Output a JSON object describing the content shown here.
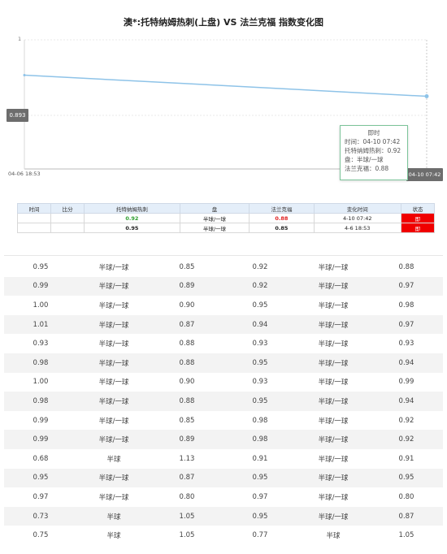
{
  "title": "澳*:托特纳姆热刺(上盘) VS 法兰克福 指数变化图",
  "chart_data": {
    "type": "line",
    "x": [
      "04-06 18:53",
      "04-10 07:42"
    ],
    "series": [
      {
        "values": [
          0.95,
          0.92
        ]
      }
    ],
    "ylim": [
      0.893,
      1
    ],
    "ytick_label": "1",
    "y_cursor_label": "0.893",
    "x_start_label": "04-06 18:53",
    "x_cursor_label": "04-10 07:42",
    "line_color": "#8ec3e8"
  },
  "tooltip": {
    "header": "即时",
    "time": "时间：04-10 07:42",
    "home": "托特纳姆热刺：0.92",
    "handicap": "盘：半球/一球",
    "away": "法兰克福：0.88"
  },
  "small_table": {
    "headers": [
      "时间",
      "比分",
      "托特纳姆热刺",
      "盘",
      "法兰克福",
      "变化时间",
      "状态"
    ],
    "rows": [
      [
        "",
        "",
        "0.92",
        "半球/一球",
        "0.88",
        "4-10 07:42",
        "即"
      ],
      [
        "",
        "",
        "0.95",
        "半球/一球",
        "0.85",
        "4-6 18:53",
        "即"
      ]
    ]
  },
  "big_table": [
    [
      "0.95",
      "半球/一球",
      "0.85",
      "0.92",
      "半球/一球",
      "0.88"
    ],
    [
      "0.99",
      "半球/一球",
      "0.89",
      "0.92",
      "半球/一球",
      "0.97"
    ],
    [
      "1.00",
      "半球/一球",
      "0.90",
      "0.95",
      "半球/一球",
      "0.98"
    ],
    [
      "1.01",
      "半球/一球",
      "0.87",
      "0.94",
      "半球/一球",
      "0.97"
    ],
    [
      "0.93",
      "半球/一球",
      "0.88",
      "0.93",
      "半球/一球",
      "0.93"
    ],
    [
      "0.98",
      "半球/一球",
      "0.88",
      "0.95",
      "半球/一球",
      "0.94"
    ],
    [
      "1.00",
      "半球/一球",
      "0.90",
      "0.93",
      "半球/一球",
      "0.99"
    ],
    [
      "0.98",
      "半球/一球",
      "0.88",
      "0.95",
      "半球/一球",
      "0.94"
    ],
    [
      "0.99",
      "半球/一球",
      "0.85",
      "0.98",
      "半球/一球",
      "0.92"
    ],
    [
      "0.99",
      "半球/一球",
      "0.89",
      "0.98",
      "半球/一球",
      "0.92"
    ],
    [
      "0.68",
      "半球",
      "1.13",
      "0.91",
      "半球/一球",
      "0.91"
    ],
    [
      "0.95",
      "半球/一球",
      "0.87",
      "0.95",
      "半球/一球",
      "0.95"
    ],
    [
      "0.97",
      "半球/一球",
      "0.80",
      "0.97",
      "半球/一球",
      "0.80"
    ],
    [
      "0.73",
      "半球",
      "1.05",
      "0.95",
      "半球/一球",
      "0.87"
    ],
    [
      "0.75",
      "半球",
      "1.05",
      "0.77",
      "半球",
      "1.05"
    ]
  ]
}
